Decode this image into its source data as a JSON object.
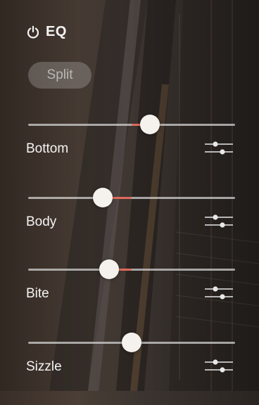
{
  "header": {
    "title": "EQ",
    "icon": "power-icon"
  },
  "split_label": "Split",
  "colors": {
    "accent": "#e06a5c",
    "thumb": "#f5f2ee",
    "track": "#d2d2d2"
  },
  "bands": [
    {
      "label": "Bottom",
      "value": 0.59,
      "center": 0.5
    },
    {
      "label": "Body",
      "value": 0.36,
      "center": 0.5
    },
    {
      "label": "Bite",
      "value": 0.39,
      "center": 0.5
    },
    {
      "label": "Sizzle",
      "value": 0.5,
      "center": 0.5
    }
  ]
}
